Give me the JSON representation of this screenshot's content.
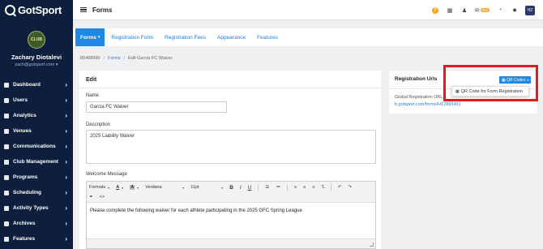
{
  "brand": {
    "name": "GotSport",
    "accent": "#1e88e5",
    "sidebar_bg": "#0d1f3c",
    "highlight": "#e21c1c"
  },
  "profile": {
    "avatar_text": "CLUB",
    "name": "Zachary Diotalevi",
    "email": "zach@gotsport.com"
  },
  "sidebar": {
    "items": [
      {
        "label": "Dashboard",
        "icon": "dashboard-icon"
      },
      {
        "label": "Users",
        "icon": "users-icon"
      },
      {
        "label": "Analytics",
        "icon": "analytics-icon"
      },
      {
        "label": "Venues",
        "icon": "venues-icon"
      },
      {
        "label": "Communications",
        "icon": "communications-icon"
      },
      {
        "label": "Club Management",
        "icon": "club-management-icon"
      },
      {
        "label": "Programs",
        "icon": "programs-icon"
      },
      {
        "label": "Scheduling",
        "icon": "scheduling-icon"
      },
      {
        "label": "Activity Types",
        "icon": "activity-types-icon"
      },
      {
        "label": "Archives",
        "icon": "archives-icon"
      },
      {
        "label": "Features",
        "icon": "features-icon"
      }
    ]
  },
  "topbar": {
    "title": "Forms",
    "help": "?",
    "mail_badge": "999",
    "user_initials": "HZ"
  },
  "tabs": [
    {
      "label": "Forms",
      "active": true
    },
    {
      "label": "Registration Form"
    },
    {
      "label": "Registration Fees"
    },
    {
      "label": "Appearance"
    },
    {
      "label": "Features"
    }
  ],
  "breadcrumb": {
    "id": "80488990",
    "forms": "Forms",
    "current": "Edit Garcia FC Waiver"
  },
  "edit": {
    "title": "Edit",
    "name_label": "Name",
    "name_value": "Garcia FC Waiver",
    "description_label": "Description",
    "description_value": "2025 Liability Waiver",
    "welcome_label": "Welcome Message",
    "toolbar": {
      "formats": "Formats",
      "font": "Verdana",
      "size": "11pt"
    },
    "body": "Please complete the following waiver for each athlete participating in the 2025 GFC Spring League"
  },
  "registration": {
    "title": "Registration Urls",
    "qr_button": "QR Codes",
    "qr_menu_item": "QR Code for Form Registration",
    "global_label": "Global Registration URL",
    "global_link": "b.gotsport.com/forms/H12865491"
  }
}
